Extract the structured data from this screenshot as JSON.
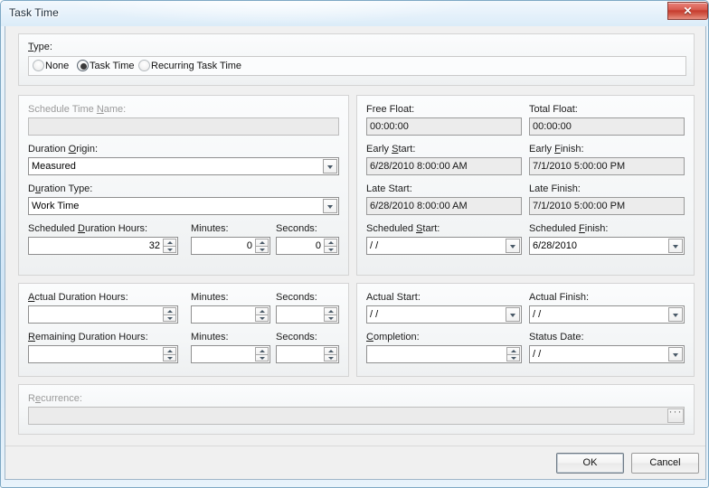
{
  "window": {
    "title": "Task Time",
    "close_label": "✕"
  },
  "type_section": {
    "label": "Type:",
    "options": [
      {
        "label": "None",
        "selected": false
      },
      {
        "label": "Task Time",
        "selected": true
      },
      {
        "label": "Recurring Task Time",
        "selected": false
      }
    ]
  },
  "schedule": {
    "name_label": "Schedule Time Name:",
    "name_value": "",
    "duration_origin_label": "Duration Origin:",
    "duration_origin_value": "Measured",
    "duration_type_label": "Duration Type:",
    "duration_type_value": "Work Time",
    "sched_hours_label": "Scheduled Duration Hours:",
    "sched_hours_value": "32",
    "sched_minutes_label": "Minutes:",
    "sched_minutes_value": "0",
    "sched_seconds_label": "Seconds:",
    "sched_seconds_value": "0"
  },
  "floats": {
    "free_float_label": "Free Float:",
    "free_float_value": "00:00:00",
    "total_float_label": "Total Float:",
    "total_float_value": "00:00:00",
    "early_start_label": "Early Start:",
    "early_start_value": "6/28/2010 8:00:00 AM",
    "early_finish_label": "Early Finish:",
    "early_finish_value": "7/1/2010 5:00:00 PM",
    "late_start_label": "Late Start:",
    "late_start_value": "6/28/2010 8:00:00 AM",
    "late_finish_label": "Late Finish:",
    "late_finish_value": "7/1/2010 5:00:00 PM",
    "sched_start_label": "Scheduled Start:",
    "sched_start_value": "  /  /",
    "sched_finish_label": "Scheduled Finish:",
    "sched_finish_value": "6/28/2010"
  },
  "actuals": {
    "actual_hours_label": "Actual Duration Hours:",
    "actual_hours_value": "",
    "actual_minutes_label": "Minutes:",
    "actual_minutes_value": "",
    "actual_seconds_label": "Seconds:",
    "actual_seconds_value": "",
    "remaining_hours_label": "Remaining Duration Hours:",
    "remaining_hours_value": "",
    "remaining_minutes_label": "Minutes:",
    "remaining_minutes_value": "",
    "remaining_seconds_label": "Seconds:",
    "remaining_seconds_value": ""
  },
  "actual_dates": {
    "actual_start_label": "Actual Start:",
    "actual_start_value": "  /  /",
    "actual_finish_label": "Actual Finish:",
    "actual_finish_value": "  /  /",
    "completion_label": "Completion:",
    "completion_value": "",
    "status_date_label": "Status Date:",
    "status_date_value": "  /  /"
  },
  "recurrence": {
    "label": "Recurrence:",
    "value": "",
    "browse_label": "..."
  },
  "buttons": {
    "ok": "OK",
    "cancel": "Cancel"
  }
}
